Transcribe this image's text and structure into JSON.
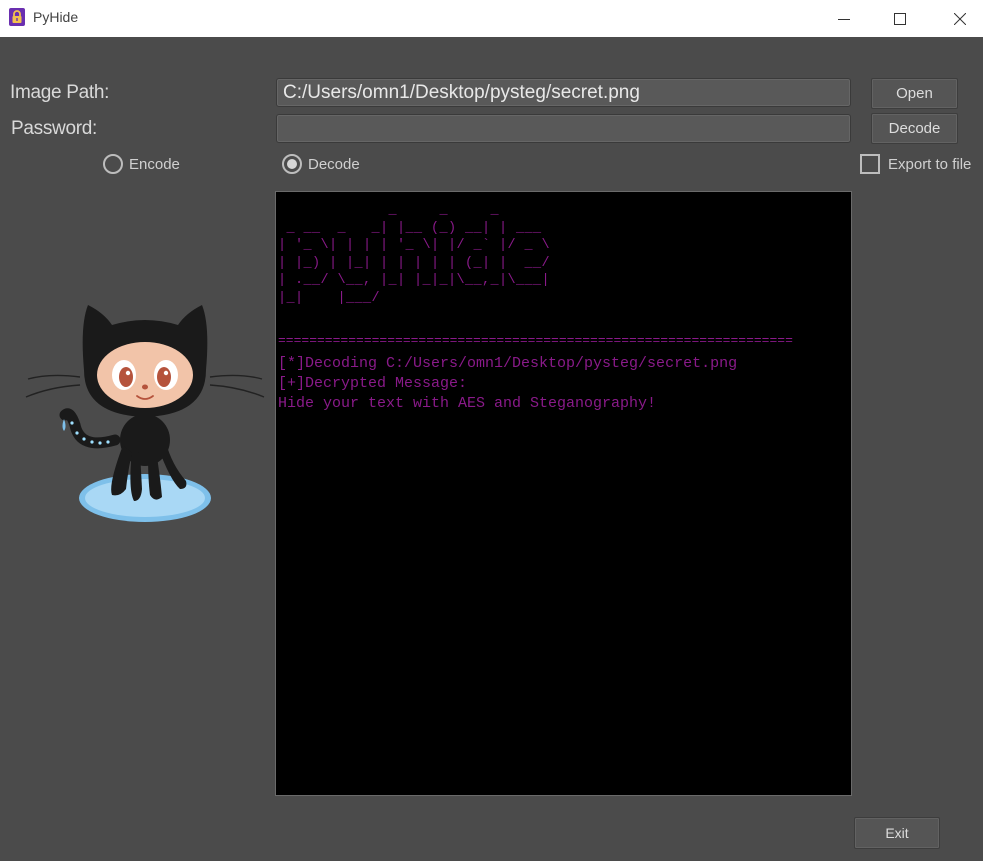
{
  "window": {
    "title": "PyHide"
  },
  "form": {
    "image_path_label": "Image Path:",
    "image_path_value": "C:/Users/omn1/Desktop/pysteg/secret.png",
    "password_label": "Password:",
    "password_value": "",
    "open_button": "Open",
    "action_button": "Decode",
    "mode_options": [
      {
        "label": "Encode",
        "selected": false
      },
      {
        "label": "Decode",
        "selected": true
      }
    ],
    "export_label": "Export to file",
    "export_checked": false
  },
  "console": {
    "banner": "             _     _     _\n _ __  _   _| |__ (_) __| | ___\n| '_ \\| | | | '_ \\| |/ _` |/ _ \\\n| |_) | |_| | | | | | (_| |  __/\n| .__/ \\__, |_| |_|_|\\__,_|\\___|\n|_|    |___/",
    "separator": "==================================================================",
    "lines": [
      "[*]Decoding C:/Users/omn1/Desktop/pysteg/secret.png",
      "[+]Decrypted Message:",
      "Hide your text with AES and Steganography!"
    ],
    "text_color": "#8a1a8a"
  },
  "footer": {
    "exit_button": "Exit"
  },
  "icons": {
    "app": "padlock-icon",
    "mascot": "octocat-image"
  }
}
